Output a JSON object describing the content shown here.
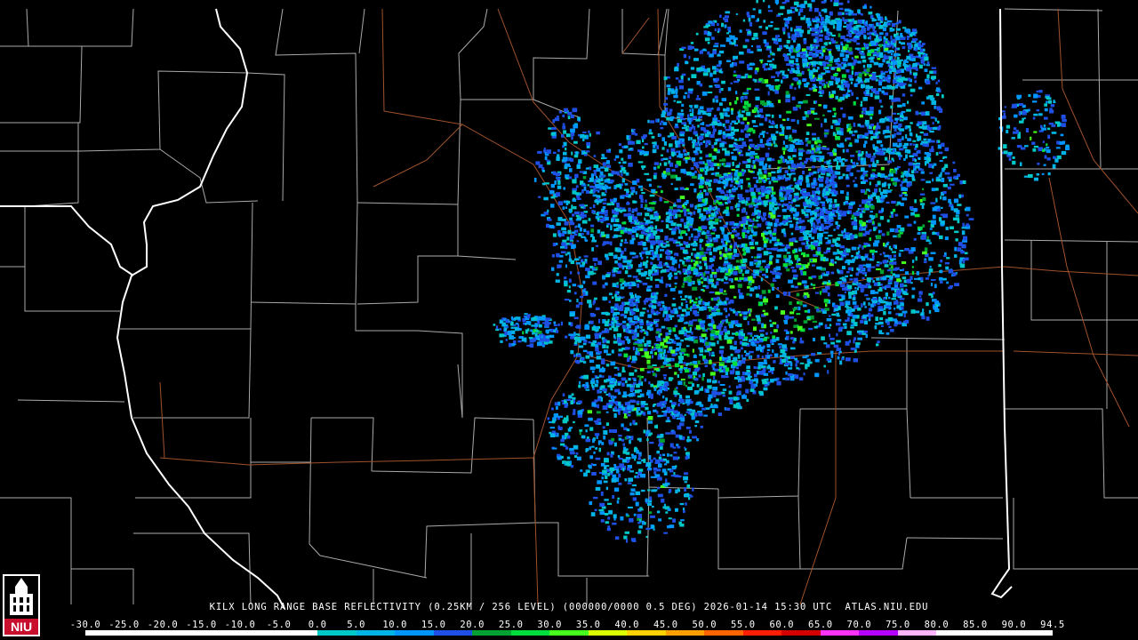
{
  "product": {
    "caption": "KILX LONG RANGE BASE REFLECTIVITY (0.25KM / 256 LEVEL) (000000/0000 0.5 DEG) 2026-01-14 15:30 UTC  ATLAS.NIU.EDU"
  },
  "scale": {
    "labels": [
      "-30.0",
      "-25.0",
      "-20.0",
      "-15.0",
      "-10.0",
      "-5.0",
      "0.0",
      "5.0",
      "10.0",
      "15.0",
      "20.0",
      "25.0",
      "30.0",
      "35.0",
      "40.0",
      "45.0",
      "50.0",
      "55.0",
      "60.0",
      "65.0",
      "70.0",
      "75.0",
      "80.0",
      "85.0",
      "90.0",
      "94.5"
    ],
    "colors": [
      "#ffffff",
      "#ffffff",
      "#ffffff",
      "#ffffff",
      "#ffffff",
      "#ffffff",
      "#00c8c8",
      "#00b4e6",
      "#0096ff",
      "#1e50e6",
      "#00a032",
      "#00dc3c",
      "#46ff1e",
      "#dcff00",
      "#ffd200",
      "#ffa000",
      "#ff6400",
      "#ff1e00",
      "#d20000",
      "#ff32ff",
      "#b400ff",
      "#ffb4ff",
      "#ffffff",
      "#ffffff",
      "#ffffff"
    ]
  },
  "logo": {
    "text": "NIU"
  },
  "colors": {
    "state_border": "#ffffff",
    "county_border": "#aaaaaa",
    "highway": "#a0522d",
    "background": "#000000"
  }
}
